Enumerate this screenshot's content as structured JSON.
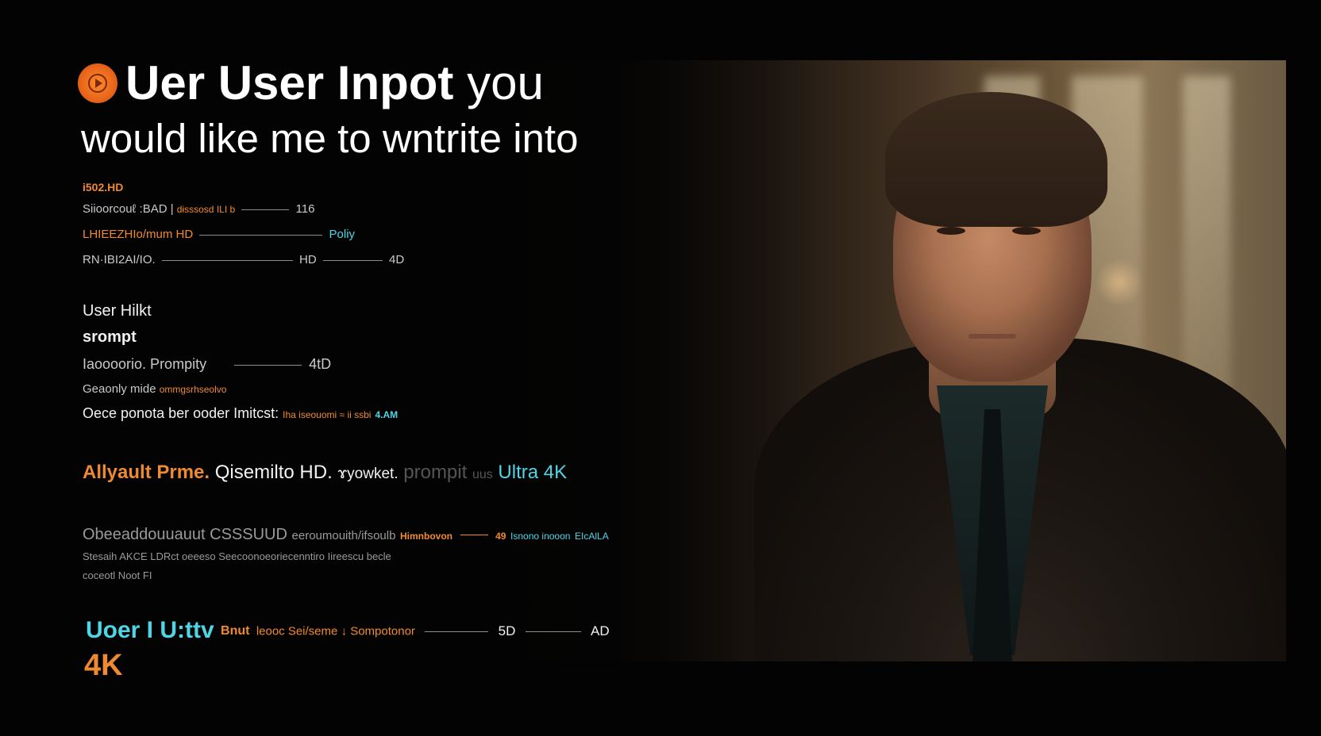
{
  "title": {
    "line1_bold": "Uer User Inpot",
    "line1_light": "you",
    "line2": "would like me to wntrite into"
  },
  "spec_block": {
    "header": "i502.HD",
    "row1": {
      "left": "Siioorcouℓ :BAD |",
      "mid": "dɨsssosd   ILI b",
      "right": "116"
    },
    "row2": {
      "left": "LHIEEZHIo/mum HD",
      "right": "Poliy"
    },
    "row3": {
      "left": "RN·IBI2AI/IO.",
      "mid": "HD",
      "right": "4D"
    }
  },
  "prompt_block": {
    "label1": "User Hilkt",
    "label2": "srompt",
    "row1": {
      "left": "Iaoooorio. Prompity",
      "right": "4tD"
    },
    "row2": {
      "left": "Geaonly mide",
      "right": "ommgsrhseolvo"
    },
    "row3": {
      "left": "Oece ponota ber ooder Imitcst:",
      "mid": "Iha iseouomi ≈ ii ssbi",
      "right": "4.AM"
    }
  },
  "feature_line": {
    "part1": "Allyault Prme.",
    "part2": "Qisemilto HD.",
    "part3": "ɤyowket.",
    "part4": "prompit",
    "part5": "uus",
    "part6": "Ultra 4K"
  },
  "bottom_block": {
    "row1": {
      "left": "Obeeaddouuauut CSSSUUD",
      "mid": "eeroumouith/ifsoulb",
      "orange": "Himnbovon",
      "num": "49",
      "cyan": "Isnono inooon",
      "end": "EIcAlLA"
    },
    "row2": "Stesaih AKCE LDRct oeeeso   Seecoonoeoriecenntiro Iireescu becle",
    "row3": "coceotl Noot FI"
  },
  "footer": {
    "cyan_label": "Uoer I U:ttv",
    "orange_label": "Bnut",
    "text": "leooc Sei/seme  ↓ Sompotonor",
    "mid": "5D",
    "right": "AD",
    "badge": "4K"
  },
  "colors": {
    "accent_orange": "#f08a30",
    "accent_cyan": "#4fd6e6",
    "background": "#030303"
  },
  "icons": [
    "play-logo-icon"
  ]
}
